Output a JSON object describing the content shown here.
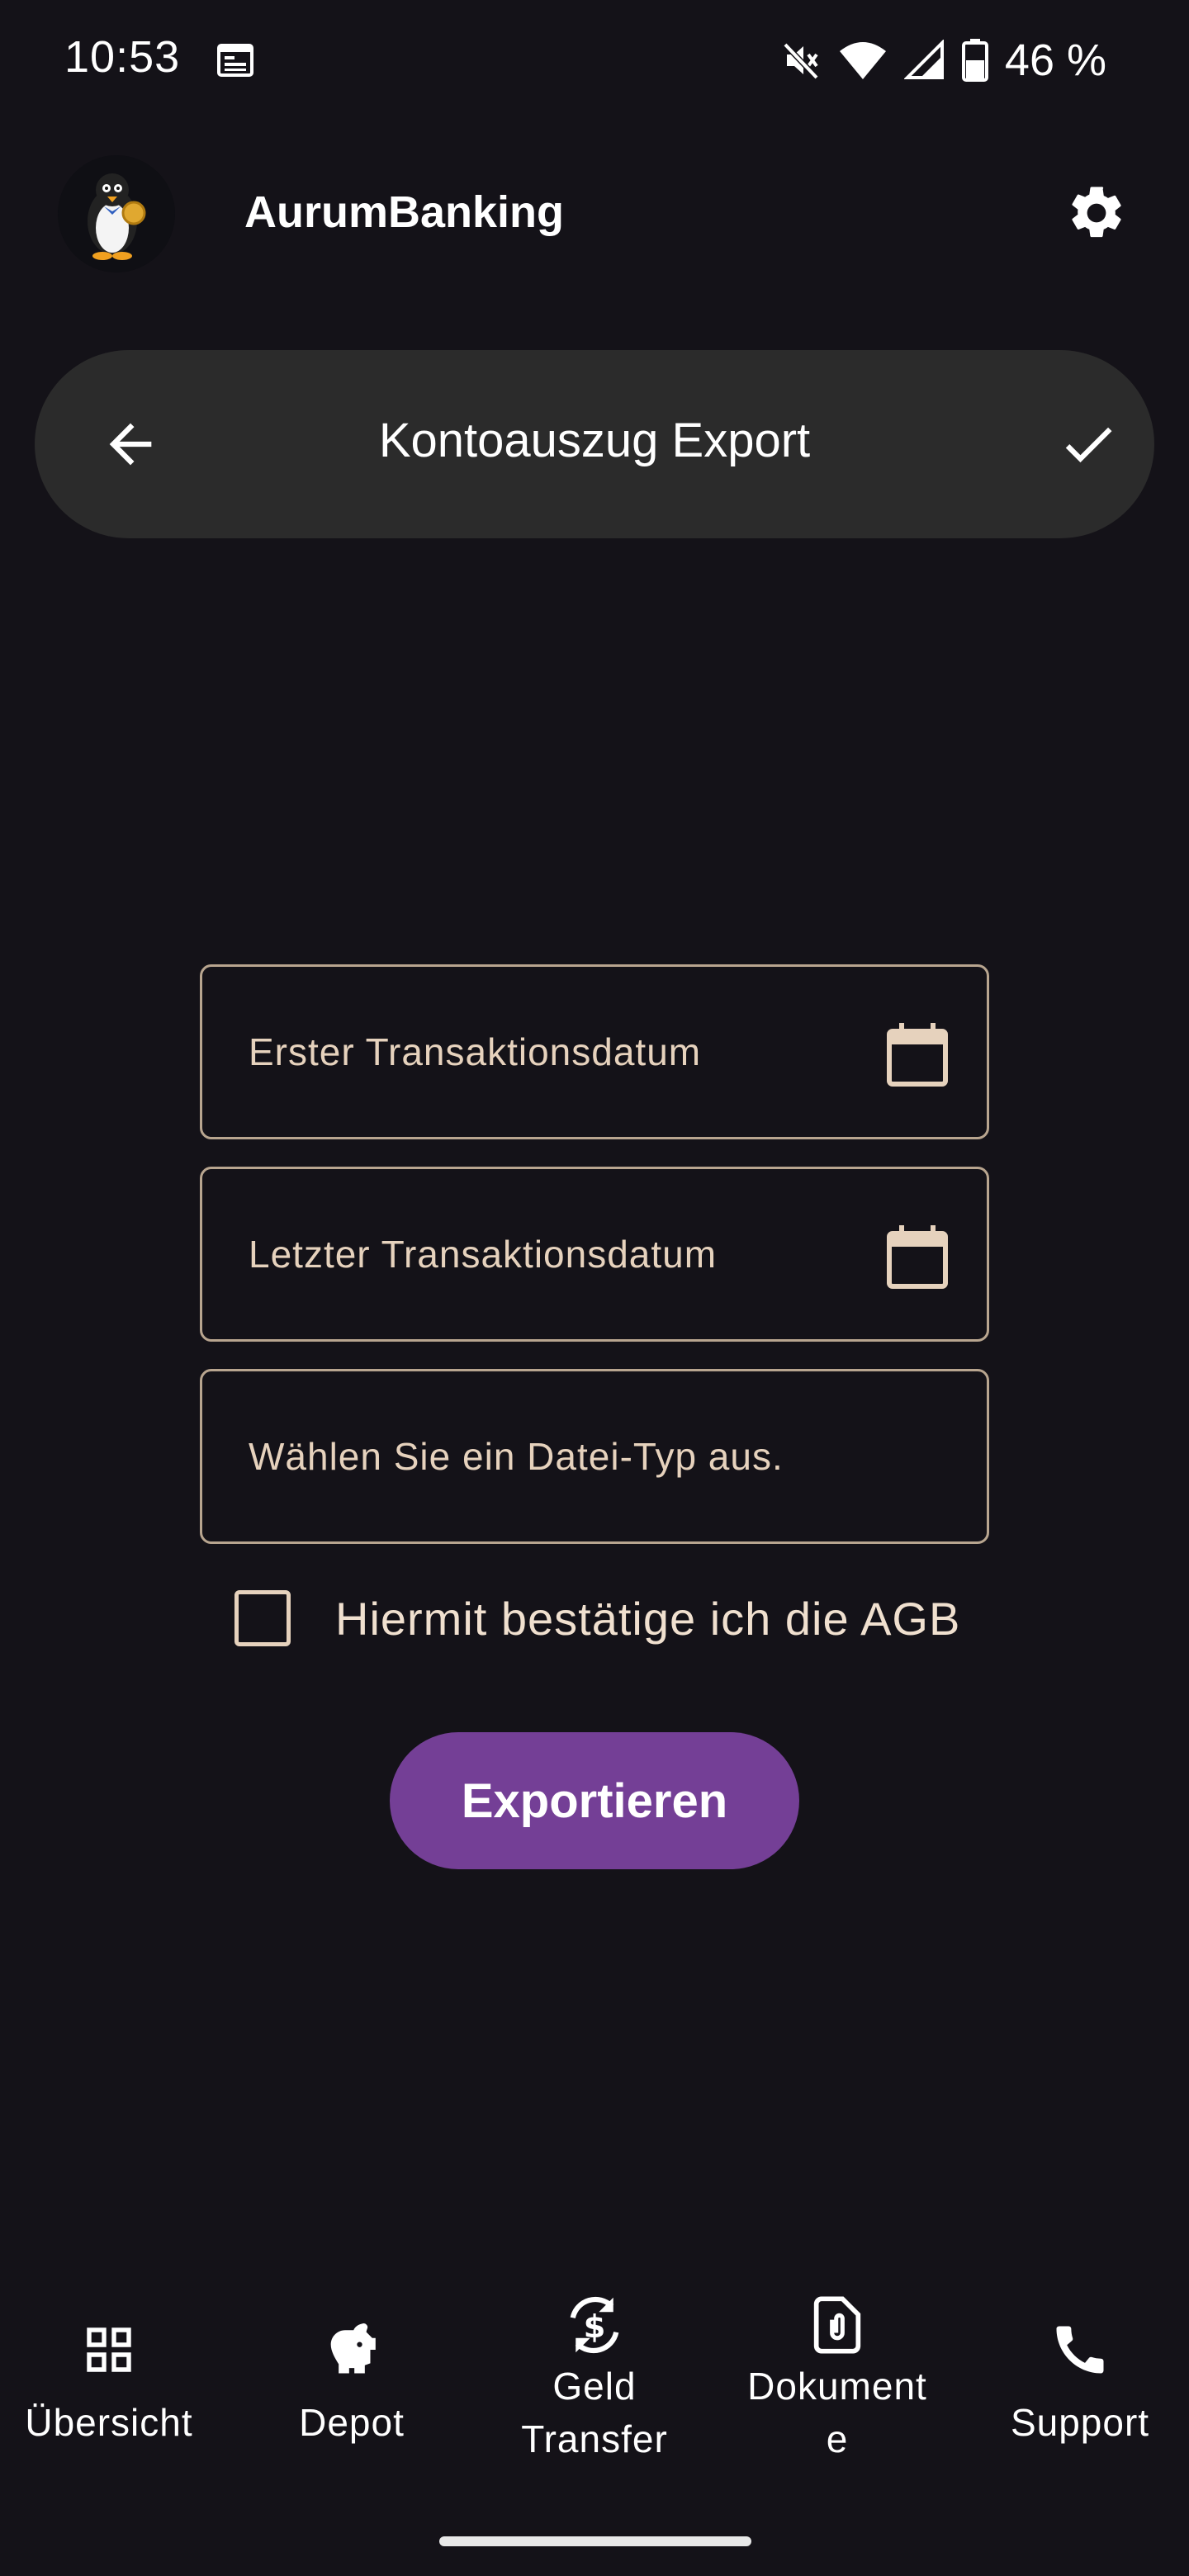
{
  "status_bar": {
    "time": "10:53",
    "battery": "46 %",
    "icons": [
      "calendar-icon",
      "mute-icon",
      "wifi-icon",
      "signal-icon",
      "battery-icon"
    ]
  },
  "header": {
    "app_name": "AurumBanking",
    "avatar_icon": "penguin-logo",
    "settings_icon": "gear-icon"
  },
  "top_bar": {
    "title": "Kontoauszug Export",
    "back_icon": "arrow-left-icon",
    "confirm_icon": "check-icon"
  },
  "form": {
    "first_date_placeholder": "Erster Transaktionsdatum",
    "last_date_placeholder": "Letzter Transaktionsdatum",
    "file_type_placeholder": "Wählen Sie ein Datei-Typ aus.",
    "agb_label": "Hiermit bestätige ich die AGB",
    "agb_checked": false,
    "export_label": "Exportieren"
  },
  "bottom_nav": {
    "items": [
      {
        "label": "Übersicht",
        "icon": "grid-icon"
      },
      {
        "label": "Depot",
        "icon": "piggy-bank-icon"
      },
      {
        "label": "Geld Transfer",
        "line1": "Geld",
        "line2": "Transfer",
        "icon": "currency-exchange-icon"
      },
      {
        "label": "Dokumente",
        "line1": "Dokument",
        "line2": "e",
        "icon": "document-attach-icon"
      },
      {
        "label": "Support",
        "icon": "phone-icon"
      }
    ]
  },
  "colors": {
    "background": "#141218",
    "card": "#2b2b2b",
    "accent": "#743f96",
    "field_border": "#b8a58f",
    "field_text": "#e6d2bd"
  }
}
